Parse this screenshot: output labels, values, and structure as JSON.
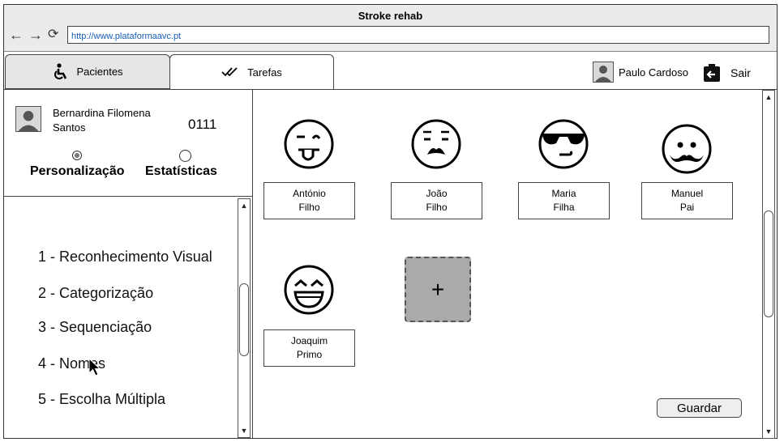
{
  "window": {
    "title": "Stroke rehab",
    "url": "http://www.plataformaavc.pt"
  },
  "nav": {
    "back": "←",
    "forward": "→",
    "reload": "⟳"
  },
  "tabs": [
    {
      "label": "Pacientes",
      "icon": "wheelchair-icon",
      "active": false
    },
    {
      "label": "Tarefas",
      "icon": "double-check-icon",
      "active": true
    }
  ],
  "header": {
    "user_name": "Paulo Cardoso",
    "logout_label": "Sair"
  },
  "patient": {
    "name_line1": "Bernardina Filomena",
    "name_line2": "Santos",
    "id": "0111",
    "options": [
      {
        "label": "Personalização",
        "selected": true
      },
      {
        "label": "Estatísticas",
        "selected": false
      }
    ]
  },
  "menu": {
    "items": [
      "1 - Reconhecimento Visual",
      "2 - Categorização",
      "3 - Sequenciação",
      "4 - Nomes",
      "5 - Escolha Múltipla"
    ]
  },
  "family": [
    {
      "line1": "António",
      "line2": "Filho",
      "icon": "tongue-face-icon"
    },
    {
      "line1": "João",
      "line2": "Filho",
      "icon": "mustache-face-icon"
    },
    {
      "line1": "Maria",
      "line2": "Filha",
      "icon": "sunglasses-face-icon"
    },
    {
      "line1": "Manuel",
      "line2": "Pai",
      "icon": "curly-mustache-face-icon"
    },
    {
      "line1": "Joaquim",
      "line2": "Primo",
      "icon": "laughing-face-icon"
    }
  ],
  "add_label": "+",
  "save_label": "Guardar"
}
